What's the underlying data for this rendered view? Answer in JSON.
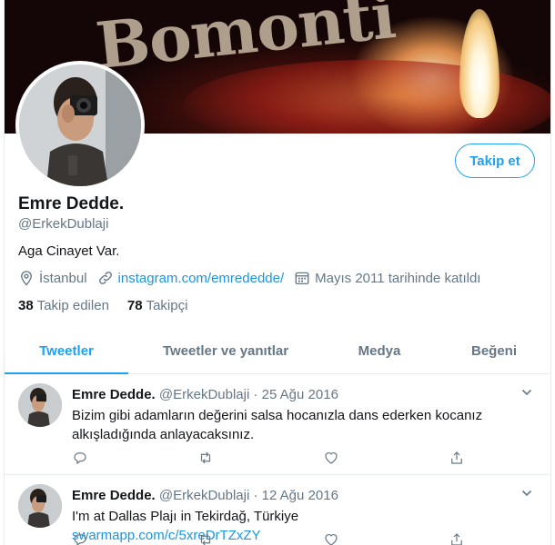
{
  "banner": {
    "text": "Bomonti"
  },
  "profile": {
    "name": "Emre Dedde.",
    "handle": "@ErkekDublaji",
    "bio": "Aga Cinayet Var.",
    "location": "İstanbul",
    "website": "instagram.com/emrededde/",
    "joined": "Mayıs 2011 tarihinde katıldı",
    "following_count": "38",
    "following_label": "Takip edilen",
    "followers_count": "78",
    "followers_label": "Takipçi",
    "follow_button": "Takip et"
  },
  "tabs": [
    "Tweetler",
    "Tweetler ve yanıtlar",
    "Medya",
    "Beğeni"
  ],
  "active_tab": "Tweetler",
  "tweets": [
    {
      "name": "Emre Dedde.",
      "handle": "@ErkekDublaji",
      "sep": "·",
      "date": "25 Ağu 2016",
      "text": "Bizim gibi adamların değerini salsa hocanızla dans ederken kocanız alkışladığında anlayacaksınız."
    },
    {
      "name": "Emre Dedde.",
      "handle": "@ErkekDublaji",
      "sep": "·",
      "date": "12 Ağu 2016",
      "text": "I'm at Dallas Plajı in Tekirdağ, Türkiye",
      "link": "swarmapp.com/c/5xreDrTZxZY"
    }
  ],
  "icons": {
    "location": "map-pin-icon",
    "link": "link-icon",
    "calendar": "calendar-icon",
    "reply": "reply-icon",
    "retweet": "retweet-icon",
    "like": "heart-icon",
    "share": "share-icon",
    "caret": "chevron-down-icon"
  },
  "colors": {
    "accent": "#1da1f2",
    "link": "#1b95e0",
    "muted": "#657786",
    "text": "#14171a"
  }
}
